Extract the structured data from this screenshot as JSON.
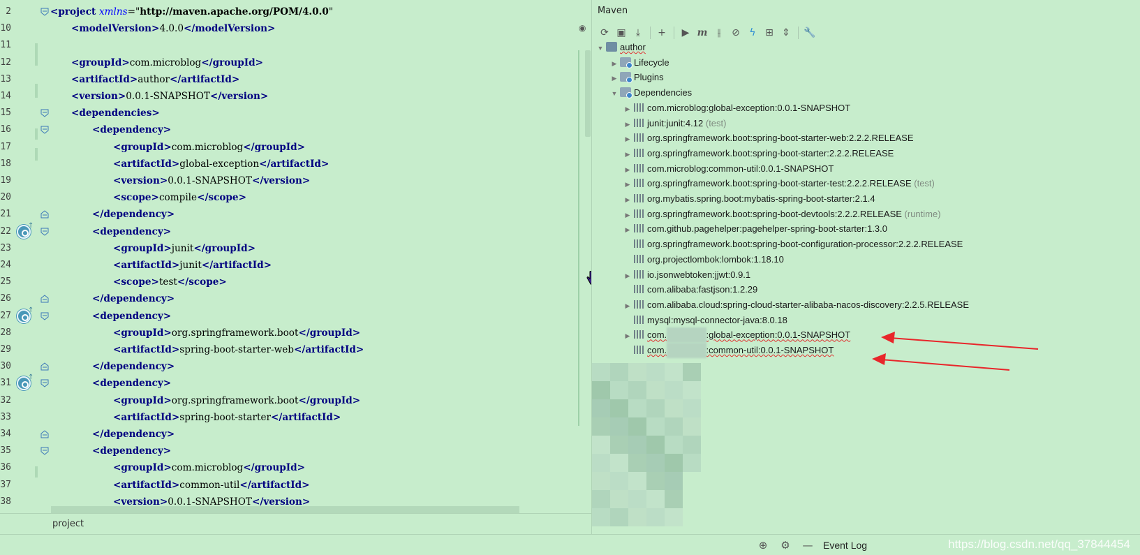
{
  "editor": {
    "lines": [
      {
        "num": "2",
        "indent": 0,
        "segments": [
          [
            "tag",
            "<project "
          ],
          [
            "attr",
            "xmlns"
          ],
          [
            "br",
            "=\""
          ],
          [
            "str",
            "http://maven.apache.org/POM/4.0.0"
          ],
          [
            "br",
            "\""
          ]
        ]
      },
      {
        "num": "10",
        "indent": 1,
        "segments": [
          [
            "tag",
            "<modelVersion>"
          ],
          [
            "br",
            "4.0.0"
          ],
          [
            "tag",
            "</modelVersion>"
          ]
        ]
      },
      {
        "num": "11",
        "indent": 0,
        "segments": []
      },
      {
        "num": "12",
        "indent": 1,
        "segments": [
          [
            "tag",
            "<groupId>"
          ],
          [
            "br",
            "com.microblog"
          ],
          [
            "tag",
            "</groupId>"
          ]
        ]
      },
      {
        "num": "13",
        "indent": 1,
        "segments": [
          [
            "tag",
            "<artifactId>"
          ],
          [
            "br",
            "author"
          ],
          [
            "tag",
            "</artifactId>"
          ]
        ]
      },
      {
        "num": "14",
        "indent": 1,
        "segments": [
          [
            "tag",
            "<version>"
          ],
          [
            "br",
            "0.0.1-SNAPSHOT"
          ],
          [
            "tag",
            "</version>"
          ]
        ]
      },
      {
        "num": "15",
        "indent": 1,
        "segments": [
          [
            "tag",
            "<dependencies>"
          ]
        ]
      },
      {
        "num": "16",
        "indent": 2,
        "segments": [
          [
            "tag",
            "<dependency>"
          ]
        ]
      },
      {
        "num": "17",
        "indent": 3,
        "segments": [
          [
            "tag",
            "<groupId>"
          ],
          [
            "br",
            "com.microblog"
          ],
          [
            "tag",
            "</groupId>"
          ]
        ]
      },
      {
        "num": "18",
        "indent": 3,
        "segments": [
          [
            "tag",
            "<artifactId>"
          ],
          [
            "br",
            "global-exception"
          ],
          [
            "tag",
            "</artifactId>"
          ]
        ]
      },
      {
        "num": "19",
        "indent": 3,
        "segments": [
          [
            "tag",
            "<version>"
          ],
          [
            "br",
            "0.0.1-SNAPSHOT"
          ],
          [
            "tag",
            "</version>"
          ]
        ]
      },
      {
        "num": "20",
        "indent": 3,
        "segments": [
          [
            "tag",
            "<scope>"
          ],
          [
            "br",
            "compile"
          ],
          [
            "tag",
            "</scope>"
          ]
        ]
      },
      {
        "num": "21",
        "indent": 2,
        "segments": [
          [
            "tag",
            "</dependency>"
          ]
        ]
      },
      {
        "num": "22",
        "indent": 2,
        "segments": [
          [
            "tag",
            "<dependency>"
          ]
        ]
      },
      {
        "num": "23",
        "indent": 3,
        "segments": [
          [
            "tag",
            "<groupId>"
          ],
          [
            "br",
            "junit"
          ],
          [
            "tag",
            "</groupId>"
          ]
        ]
      },
      {
        "num": "24",
        "indent": 3,
        "segments": [
          [
            "tag",
            "<artifactId>"
          ],
          [
            "br",
            "junit"
          ],
          [
            "tag",
            "</artifactId>"
          ]
        ]
      },
      {
        "num": "25",
        "indent": 3,
        "segments": [
          [
            "tag",
            "<scope>"
          ],
          [
            "br",
            "test"
          ],
          [
            "tag",
            "</scope>"
          ]
        ]
      },
      {
        "num": "26",
        "indent": 2,
        "segments": [
          [
            "tag",
            "</dependency>"
          ]
        ]
      },
      {
        "num": "27",
        "indent": 2,
        "segments": [
          [
            "tag",
            "<dependency>"
          ]
        ]
      },
      {
        "num": "28",
        "indent": 3,
        "segments": [
          [
            "tag",
            "<groupId>"
          ],
          [
            "br",
            "org.springframework.boot"
          ],
          [
            "tag",
            "</groupId>"
          ]
        ]
      },
      {
        "num": "29",
        "indent": 3,
        "segments": [
          [
            "tag",
            "<artifactId>"
          ],
          [
            "br",
            "spring-boot-starter-web"
          ],
          [
            "tag",
            "</artifactId>"
          ]
        ]
      },
      {
        "num": "30",
        "indent": 2,
        "segments": [
          [
            "tag",
            "</dependency>"
          ]
        ]
      },
      {
        "num": "31",
        "indent": 2,
        "segments": [
          [
            "tag",
            "<dependency>"
          ]
        ]
      },
      {
        "num": "32",
        "indent": 3,
        "segments": [
          [
            "tag",
            "<groupId>"
          ],
          [
            "br",
            "org.springframework.boot"
          ],
          [
            "tag",
            "</groupId>"
          ]
        ]
      },
      {
        "num": "33",
        "indent": 3,
        "segments": [
          [
            "tag",
            "<artifactId>"
          ],
          [
            "br",
            "spring-boot-starter"
          ],
          [
            "tag",
            "</artifactId>"
          ]
        ]
      },
      {
        "num": "34",
        "indent": 2,
        "segments": [
          [
            "tag",
            "</dependency>"
          ]
        ]
      },
      {
        "num": "35",
        "indent": 2,
        "segments": [
          [
            "tag",
            "<dependency>"
          ]
        ]
      },
      {
        "num": "36",
        "indent": 3,
        "segments": [
          [
            "tag",
            "<groupId>"
          ],
          [
            "br",
            "com.microblog"
          ],
          [
            "tag",
            "</groupId>"
          ]
        ]
      },
      {
        "num": "37",
        "indent": 3,
        "segments": [
          [
            "tag",
            "<artifactId>"
          ],
          [
            "br",
            "common-util"
          ],
          [
            "tag",
            "</artifactId>"
          ]
        ]
      },
      {
        "num": "38",
        "indent": 3,
        "segments": [
          [
            "tag",
            "<version>"
          ],
          [
            "br",
            "0.0.1-SNAPSHOT"
          ],
          [
            "tag",
            "</version>"
          ]
        ]
      }
    ],
    "breadcrumb": "project"
  },
  "maven": {
    "title": "Maven",
    "toolbar_icons": [
      "reload-icon",
      "add-folder-icon",
      "download-icon",
      "plus-icon",
      "run-icon",
      "maven-goal-icon",
      "skip-tests-icon",
      "offline-icon",
      "lightning-icon",
      "show-dependencies-icon",
      "collapse-all-icon",
      "settings-wrench-icon"
    ],
    "root": "author",
    "lifecycle": "Lifecycle",
    "plugins": "Plugins",
    "dependencies_label": "Dependencies",
    "dependencies": [
      {
        "text": "com.microblog:global-exception:0.0.1-SNAPSHOT",
        "suffix": "",
        "expandable": true
      },
      {
        "text": "junit:junit:4.12",
        "suffix": "(test)",
        "expandable": true
      },
      {
        "text": "org.springframework.boot:spring-boot-starter-web:2.2.2.RELEASE",
        "suffix": "",
        "expandable": true
      },
      {
        "text": "org.springframework.boot:spring-boot-starter:2.2.2.RELEASE",
        "suffix": "",
        "expandable": true
      },
      {
        "text": "com.microblog:common-util:0.0.1-SNAPSHOT",
        "suffix": "",
        "expandable": true
      },
      {
        "text": "org.springframework.boot:spring-boot-starter-test:2.2.2.RELEASE",
        "suffix": "(test)",
        "expandable": true
      },
      {
        "text": "org.mybatis.spring.boot:mybatis-spring-boot-starter:2.1.4",
        "suffix": "",
        "expandable": true
      },
      {
        "text": "org.springframework.boot:spring-boot-devtools:2.2.2.RELEASE",
        "suffix": "(runtime)",
        "expandable": true
      },
      {
        "text": "com.github.pagehelper:pagehelper-spring-boot-starter:1.3.0",
        "suffix": "",
        "expandable": true
      },
      {
        "text": "org.springframework.boot:spring-boot-configuration-processor:2.2.2.RELEASE",
        "suffix": "",
        "expandable": false
      },
      {
        "text": "org.projectlombok:lombok:1.18.10",
        "suffix": "",
        "expandable": false
      },
      {
        "text": "io.jsonwebtoken:jjwt:0.9.1",
        "suffix": "",
        "expandable": true
      },
      {
        "text": "com.alibaba:fastjson:1.2.29",
        "suffix": "",
        "expandable": false
      },
      {
        "text": "com.alibaba.cloud:spring-cloud-starter-alibaba-nacos-discovery:2.2.5.RELEASE",
        "suffix": "",
        "expandable": true
      },
      {
        "text": "mysql:mysql-connector-java:8.0.18",
        "suffix": "",
        "expandable": false
      }
    ],
    "error_deps": [
      {
        "prefix": "com.",
        "hidden": "microblog",
        "rest": ":global-exception:0.0.1-SNAPSHOT",
        "expandable": true
      },
      {
        "prefix": "com.",
        "hidden": "microblog",
        "rest": ":common-util:0.0.1-SNAPSHOT",
        "expandable": false
      }
    ],
    "annotation_color": "#e8262b"
  },
  "statusbar": {
    "icons": [
      "target-icon",
      "gear-icon",
      "minimize-icon"
    ],
    "event_log": "Event Log",
    "watermark": "https://blog.csdn.net/qq_37844454"
  }
}
